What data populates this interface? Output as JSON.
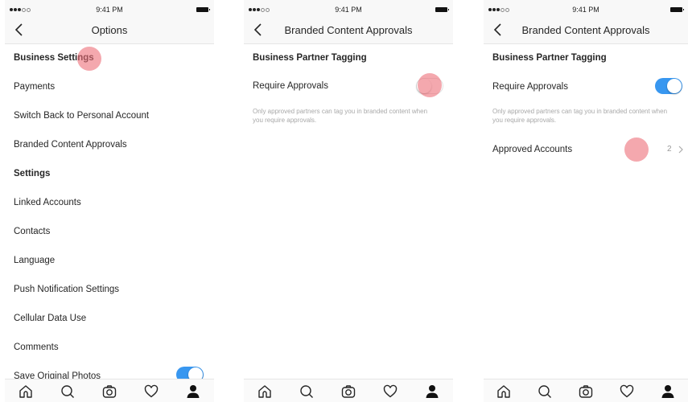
{
  "status_bar": {
    "time": "9:41 PM"
  },
  "screens": [
    {
      "title": "Options",
      "items": [
        {
          "label": "Business Settings",
          "type": "section"
        },
        {
          "label": "Payments",
          "type": "item"
        },
        {
          "label": "Switch Back to Personal Account",
          "type": "item"
        },
        {
          "label": "Branded Content Approvals",
          "type": "item"
        },
        {
          "label": "Settings",
          "type": "section"
        },
        {
          "label": "Linked Accounts",
          "type": "item"
        },
        {
          "label": "Contacts",
          "type": "item"
        },
        {
          "label": "Language",
          "type": "item"
        },
        {
          "label": "Push Notification Settings",
          "type": "item"
        },
        {
          "label": "Cellular Data Use",
          "type": "item"
        },
        {
          "label": "Comments",
          "type": "item"
        },
        {
          "label": "Save Original Photos",
          "type": "toggle",
          "value": true
        }
      ]
    },
    {
      "title": "Branded Content Approvals",
      "section": "Business Partner Tagging",
      "require_label": "Require Approvals",
      "require_value": false,
      "hint": "Only approved partners can tag you in branded content when you require approvals."
    },
    {
      "title": "Branded Content Approvals",
      "section": "Business Partner Tagging",
      "require_label": "Require Approvals",
      "require_value": true,
      "hint": "Only approved partners can tag you in branded content when you require approvals.",
      "approved_label": "Approved Accounts",
      "approved_count": "2"
    }
  ],
  "tabbar": [
    "home-icon",
    "search-icon",
    "camera-icon",
    "heart-icon",
    "profile-icon"
  ],
  "colors": {
    "accent": "#3897f0",
    "tap_indicator": "#ec6e78"
  }
}
